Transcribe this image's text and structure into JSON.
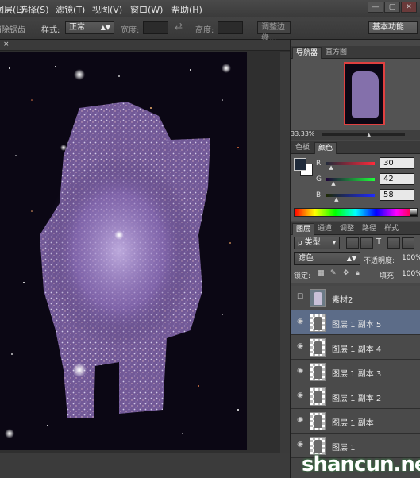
{
  "menu": [
    "图层(L)",
    "选择(S)",
    "滤镜(T)",
    "视图(V)",
    "窗口(W)",
    "帮助(H)"
  ],
  "options": {
    "clear_label": "消除锯齿",
    "style_label": "样式:",
    "style_value": "正常",
    "width_label": "宽度:",
    "height_label": "高度:",
    "refine_label": "调整边缘...",
    "workspace": "基本功能"
  },
  "navigator": {
    "tabs": [
      "导航器",
      "直方图"
    ],
    "zoom": "33.33%"
  },
  "color": {
    "tabs": [
      "色板",
      "颜色"
    ],
    "channels": [
      {
        "label": "R",
        "value": "30",
        "fraction": 0.118
      },
      {
        "label": "G",
        "value": "42",
        "fraction": 0.165
      },
      {
        "label": "B",
        "value": "58",
        "fraction": 0.227
      }
    ],
    "foreground": "#1e2a3a"
  },
  "layers": {
    "tabs": [
      "图层",
      "通道",
      "调整",
      "路径",
      "样式"
    ],
    "filter": "类型",
    "blend_mode": "滤色",
    "opacity_label": "不透明度:",
    "opacity_value": "100%",
    "lock_label": "锁定:",
    "fill_label": "填充:",
    "fill_value": "100%",
    "items": [
      {
        "name": "素材2",
        "visible": false,
        "selected": false
      },
      {
        "name": "图层 1 副本 5",
        "visible": true,
        "selected": true
      },
      {
        "name": "图层 1 副本 4",
        "visible": true,
        "selected": false
      },
      {
        "name": "图层 1 副本 3",
        "visible": true,
        "selected": false
      },
      {
        "name": "图层 1 副本 2",
        "visible": true,
        "selected": false
      },
      {
        "name": "图层 1 副本",
        "visible": true,
        "selected": false
      },
      {
        "name": "图层 1",
        "visible": true,
        "selected": false
      }
    ]
  },
  "watermark": "shancun.net"
}
